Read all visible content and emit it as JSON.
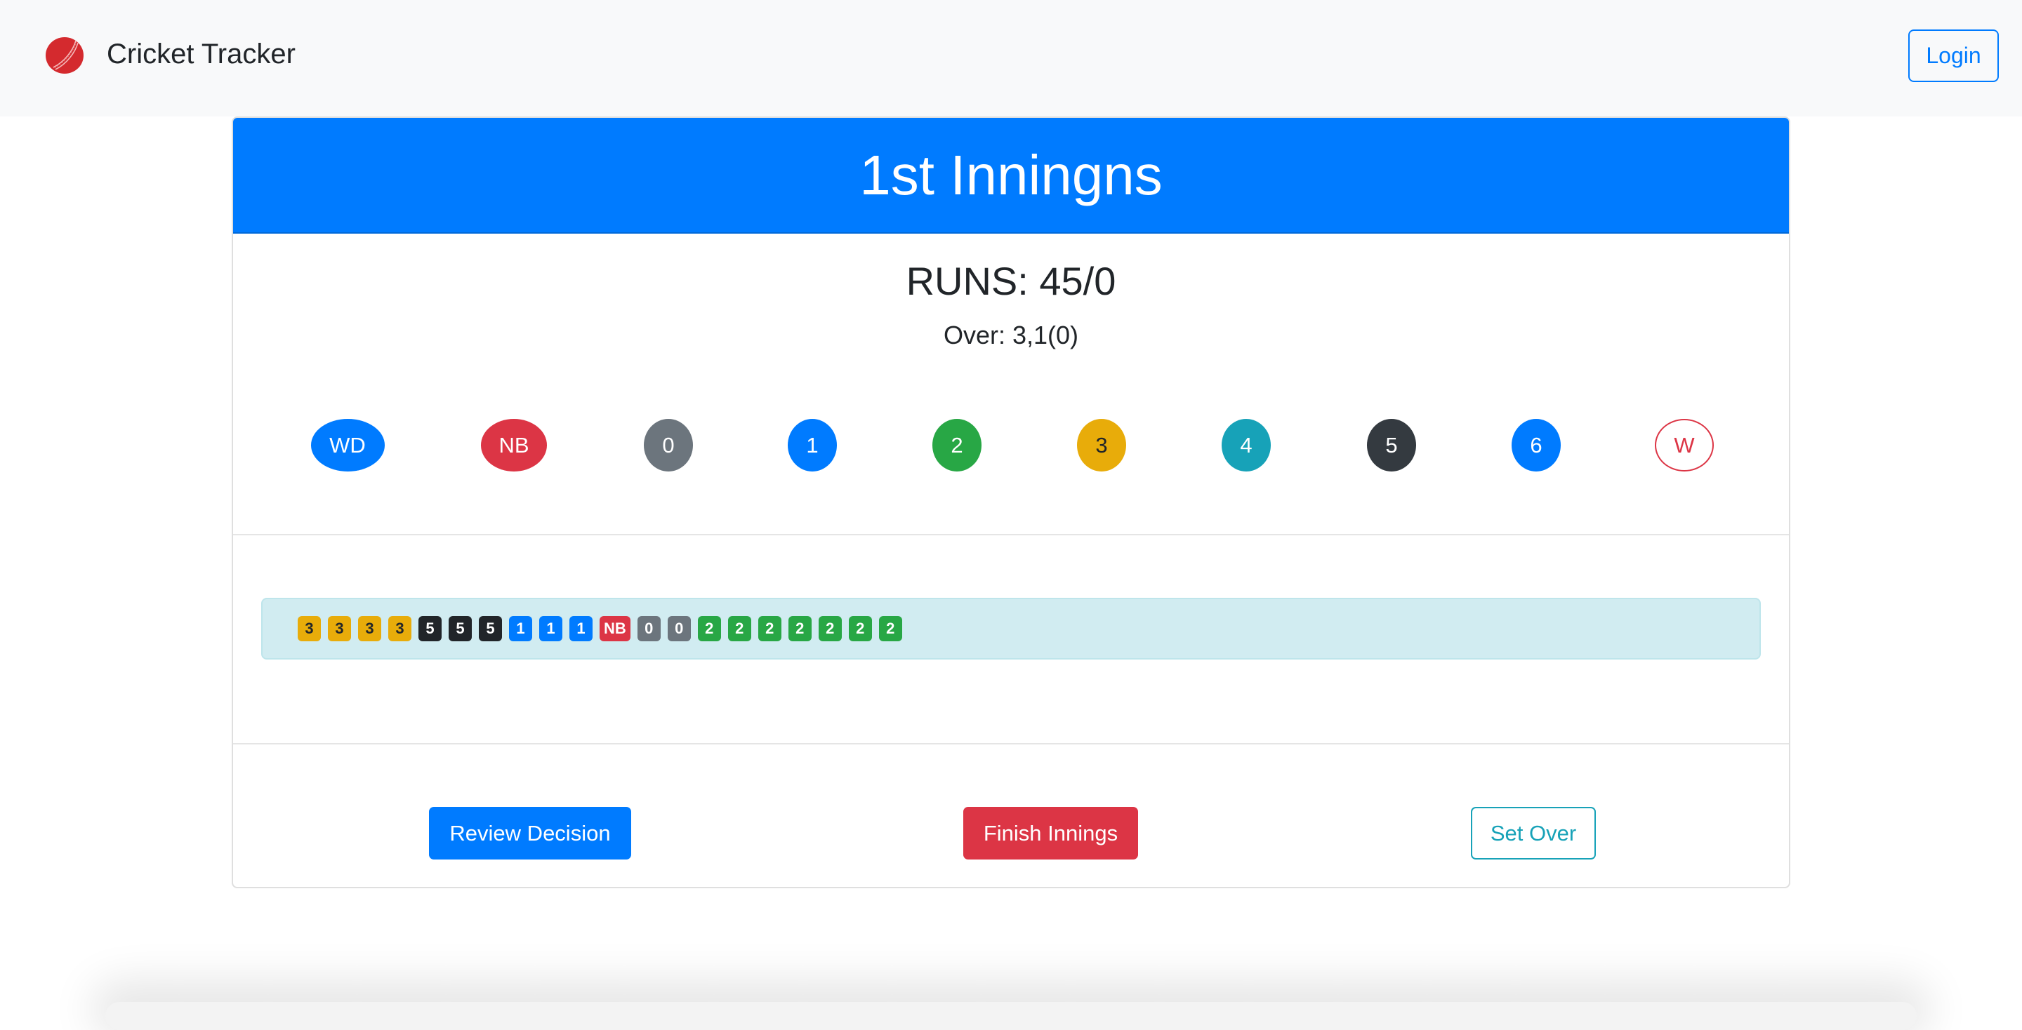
{
  "navbar": {
    "brand_title": "Cricket Tracker",
    "logo_icon": "cricket-ball-icon",
    "login_label": "Login"
  },
  "innings": {
    "title": "1st Inningns",
    "runs_text": "RUNS: 45/0",
    "over_text": "Over: 3,1(0)"
  },
  "shot_buttons": [
    {
      "label": "WD",
      "color": "#007bff",
      "text_color": "#ffffff",
      "outline": false
    },
    {
      "label": "NB",
      "color": "#dc3545",
      "text_color": "#ffffff",
      "outline": false
    },
    {
      "label": "0",
      "color": "#6c757d",
      "text_color": "#ffffff",
      "outline": false
    },
    {
      "label": "1",
      "color": "#007bff",
      "text_color": "#ffffff",
      "outline": false
    },
    {
      "label": "2",
      "color": "#28a745",
      "text_color": "#ffffff",
      "outline": false
    },
    {
      "label": "3",
      "color": "#e8ac0a",
      "text_color": "#212529",
      "outline": false
    },
    {
      "label": "4",
      "color": "#17a2b8",
      "text_color": "#ffffff",
      "outline": false
    },
    {
      "label": "5",
      "color": "#343a40",
      "text_color": "#ffffff",
      "outline": false
    },
    {
      "label": "6",
      "color": "#007bff",
      "text_color": "#ffffff",
      "outline": false
    },
    {
      "label": "W",
      "color": "#dc3545",
      "text_color": "#dc3545",
      "outline": true
    }
  ],
  "ball_log": [
    {
      "label": "3",
      "color": "#e8ac0a",
      "text_color": "#212529"
    },
    {
      "label": "3",
      "color": "#e8ac0a",
      "text_color": "#212529"
    },
    {
      "label": "3",
      "color": "#e8ac0a",
      "text_color": "#212529"
    },
    {
      "label": "3",
      "color": "#e8ac0a",
      "text_color": "#212529"
    },
    {
      "label": "5",
      "color": "#212529",
      "text_color": "#ffffff"
    },
    {
      "label": "5",
      "color": "#212529",
      "text_color": "#ffffff"
    },
    {
      "label": "5",
      "color": "#212529",
      "text_color": "#ffffff"
    },
    {
      "label": "1",
      "color": "#007bff",
      "text_color": "#ffffff"
    },
    {
      "label": "1",
      "color": "#007bff",
      "text_color": "#ffffff"
    },
    {
      "label": "1",
      "color": "#007bff",
      "text_color": "#ffffff"
    },
    {
      "label": "NB",
      "color": "#dc3545",
      "text_color": "#ffffff"
    },
    {
      "label": "0",
      "color": "#6c757d",
      "text_color": "#ffffff"
    },
    {
      "label": "0",
      "color": "#6c757d",
      "text_color": "#ffffff"
    },
    {
      "label": "2",
      "color": "#28a745",
      "text_color": "#ffffff"
    },
    {
      "label": "2",
      "color": "#28a745",
      "text_color": "#ffffff"
    },
    {
      "label": "2",
      "color": "#28a745",
      "text_color": "#ffffff"
    },
    {
      "label": "2",
      "color": "#28a745",
      "text_color": "#ffffff"
    },
    {
      "label": "2",
      "color": "#28a745",
      "text_color": "#ffffff"
    },
    {
      "label": "2",
      "color": "#28a745",
      "text_color": "#ffffff"
    },
    {
      "label": "2",
      "color": "#28a745",
      "text_color": "#ffffff"
    }
  ],
  "actions": {
    "review_label": "Review Decision",
    "finish_label": "Finish Innings",
    "set_over_label": "Set Over"
  },
  "colors": {
    "primary": "#007bff",
    "danger": "#dc3545",
    "info": "#17a2b8",
    "log_background": "#d1ecf1"
  }
}
